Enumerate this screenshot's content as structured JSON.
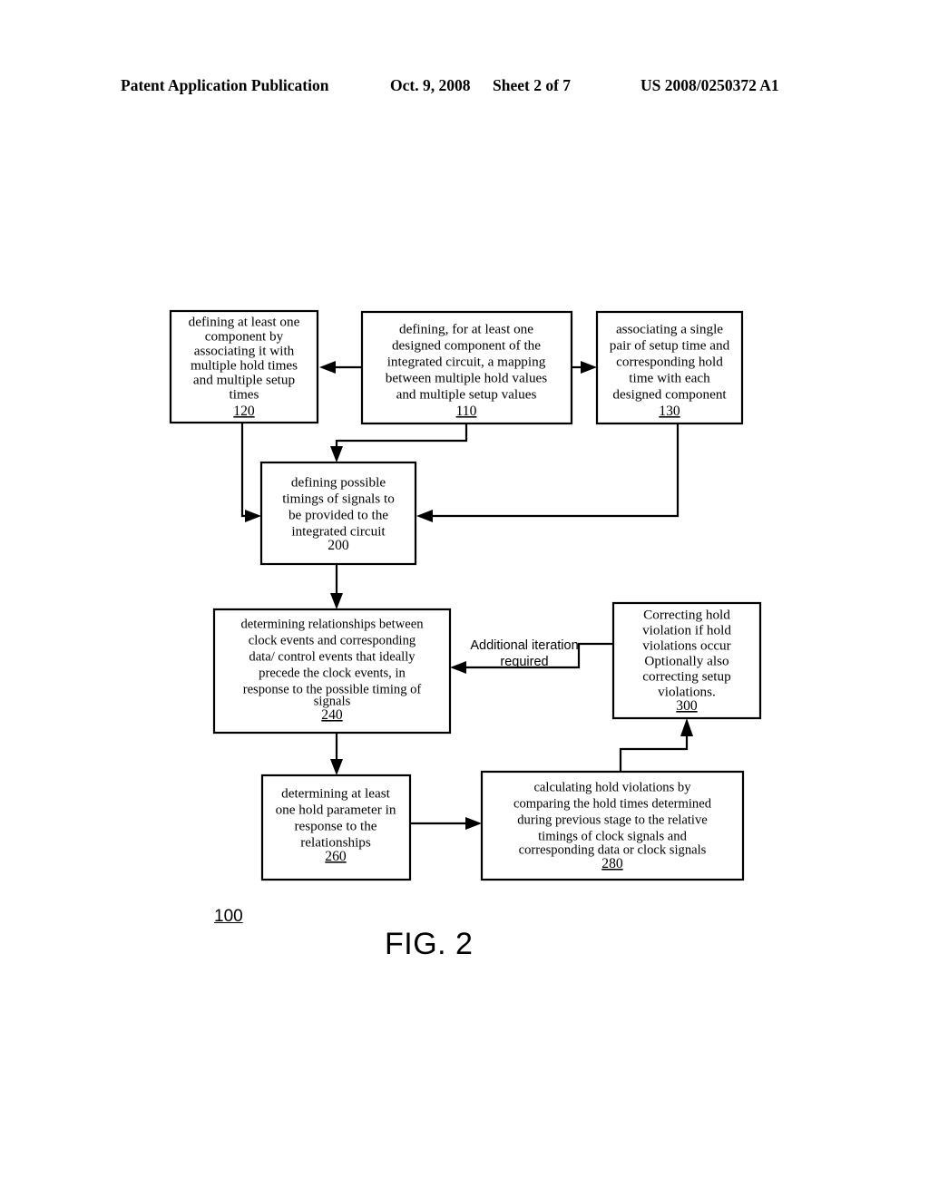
{
  "header": {
    "publication": "Patent Application Publication",
    "date": "Oct. 9, 2008",
    "sheet": "Sheet 2 of 7",
    "patent_number": "US 2008/0250372 A1"
  },
  "figure": {
    "caption": "FIG. 2",
    "reference_numeral": "100"
  },
  "nodes": {
    "n120": {
      "id": "120",
      "lines": [
        "defining at least one",
        "component by",
        "associating it with",
        "multiple hold times",
        "and multiple setup",
        "times"
      ]
    },
    "n110": {
      "id": "110",
      "lines": [
        "defining, for at least one",
        "designed component of the",
        "integrated circuit, a mapping",
        "between multiple hold values",
        "and multiple setup values"
      ]
    },
    "n130": {
      "id": "130",
      "lines": [
        "associating a single",
        "pair of setup time and",
        "corresponding hold",
        "time with each",
        "designed component"
      ]
    },
    "n200": {
      "id": "200",
      "lines": [
        "defining possible",
        "timings of signals to",
        "be provided to the",
        "integrated circuit"
      ]
    },
    "n240": {
      "id": "240",
      "lines": [
        "determining relationships between",
        "clock events and corresponding",
        "data/ control events that ideally",
        "precede the clock events, in",
        "response to the possible timing of",
        "signals"
      ]
    },
    "n300": {
      "id": "300",
      "lines": [
        "Correcting hold",
        "violation if hold",
        "violations occur",
        "Optionally also",
        "correcting setup",
        "violations."
      ]
    },
    "n260": {
      "id": "260",
      "lines": [
        "determining at least",
        "one hold parameter in",
        "response to the",
        "relationships"
      ]
    },
    "n280": {
      "id": "280",
      "lines": [
        "calculating hold violations by",
        "comparing the hold times determined",
        "during previous stage  to the relative",
        "timings of clock signals and",
        "corresponding data or clock signals"
      ]
    }
  },
  "annotations": {
    "iteration_line1": "Additional iteration",
    "iteration_line2": "required"
  },
  "colors": {
    "ink": "#000000",
    "paper": "#ffffff"
  }
}
